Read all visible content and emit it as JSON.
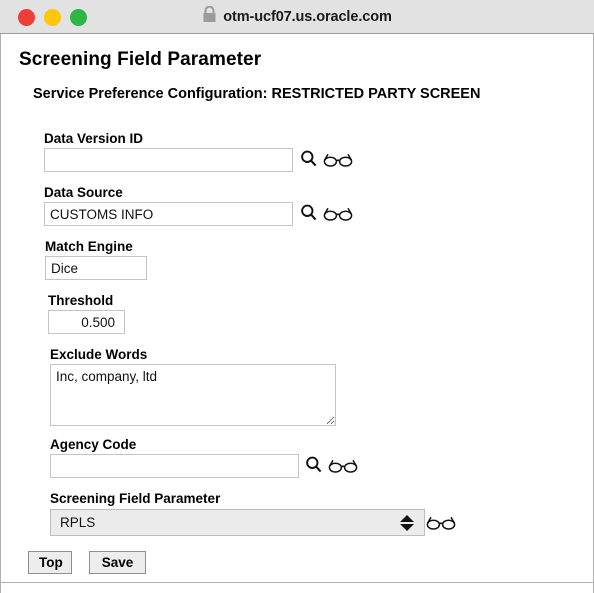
{
  "browser": {
    "lock_icon": "lock-icon",
    "url": "otm-ucf07.us.oracle.com",
    "traffic_lights": {
      "close": "close-window-button",
      "minimize": "minimize-window-button",
      "zoom": "zoom-window-button"
    },
    "colors": {
      "close": "#ee3f36",
      "minimize": "#ffc709",
      "zoom": "#2cb745",
      "titlebar_bg": "#e2e2e2"
    }
  },
  "page": {
    "title": "Screening Field Parameter",
    "subtitle": "Service Preference Configuration: RESTRICTED PARTY SCREEN"
  },
  "fields": {
    "data_version_id": {
      "label": "Data Version ID",
      "value": "",
      "search_icon": "search-icon",
      "view_icon": "glasses-icon"
    },
    "data_source": {
      "label": "Data Source",
      "value": "CUSTOMS INFO",
      "search_icon": "search-icon",
      "view_icon": "glasses-icon"
    },
    "match_engine": {
      "label": "Match Engine",
      "value": "Dice"
    },
    "threshold": {
      "label": "Threshold",
      "value": "0.500"
    },
    "exclude_words": {
      "label": "Exclude Words",
      "value": "Inc, company, ltd"
    },
    "agency_code": {
      "label": "Agency Code",
      "value": "",
      "search_icon": "search-icon",
      "view_icon": "glasses-icon"
    },
    "screening_field_parameter": {
      "label": "Screening Field Parameter",
      "value": "RPLS",
      "view_icon": "glasses-icon",
      "stepper_icon": "up-down-arrows-icon"
    }
  },
  "actions": {
    "top": "Top",
    "save": "Save"
  }
}
